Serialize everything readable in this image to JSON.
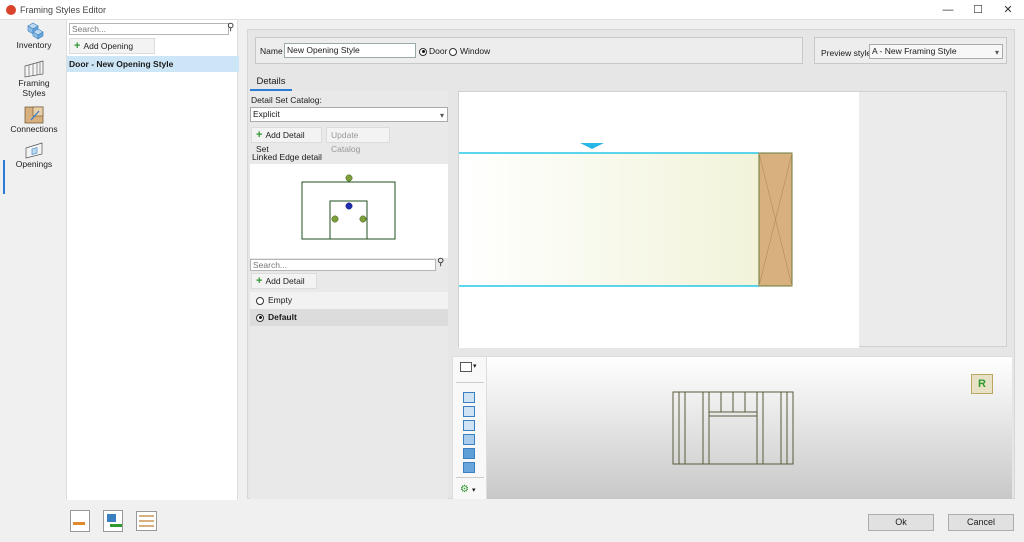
{
  "window": {
    "title": "Framing Styles Editor"
  },
  "nav": {
    "items": [
      {
        "label": "Inventory",
        "icon": "inventory-icon"
      },
      {
        "label": "Framing Styles",
        "icon": "framing-styles-icon"
      },
      {
        "label": "Connections",
        "icon": "connections-icon"
      },
      {
        "label": "Openings",
        "icon": "openings-icon"
      }
    ]
  },
  "styles_panel": {
    "search_placeholder": "Search...",
    "add_label": "Add Opening Style",
    "items": [
      "Door - New Opening Style"
    ]
  },
  "header": {
    "name_label": "Name",
    "name_value": "New Opening Style",
    "type_options": [
      "Door",
      "Window"
    ],
    "selected_type": "Door",
    "preview_label": "Preview style:",
    "preview_value": "A - New Framing Style"
  },
  "tabs": [
    "Details"
  ],
  "details": {
    "catalog_label": "Detail Set Catalog:",
    "catalog_value": "Explicit",
    "add_detail_set_label": "Add Detail Set",
    "update_catalog_label": "Update Catalog",
    "linked_edge_label": "Linked Edge detail",
    "search_placeholder": "Search...",
    "add_detail_label": "Add Detail",
    "options": [
      {
        "label": "Empty",
        "selected": false
      },
      {
        "label": "Default",
        "selected": true
      }
    ]
  },
  "preview_3d": {
    "badge": "R"
  },
  "dialog": {
    "ok_label": "Ok",
    "cancel_label": "Cancel"
  },
  "colors": {
    "accent": "#2a7bd4",
    "selection": "#cde6f7",
    "wood": "#d7b07d",
    "cyan": "#27c8e8",
    "green_plus": "#2f9a2f"
  }
}
